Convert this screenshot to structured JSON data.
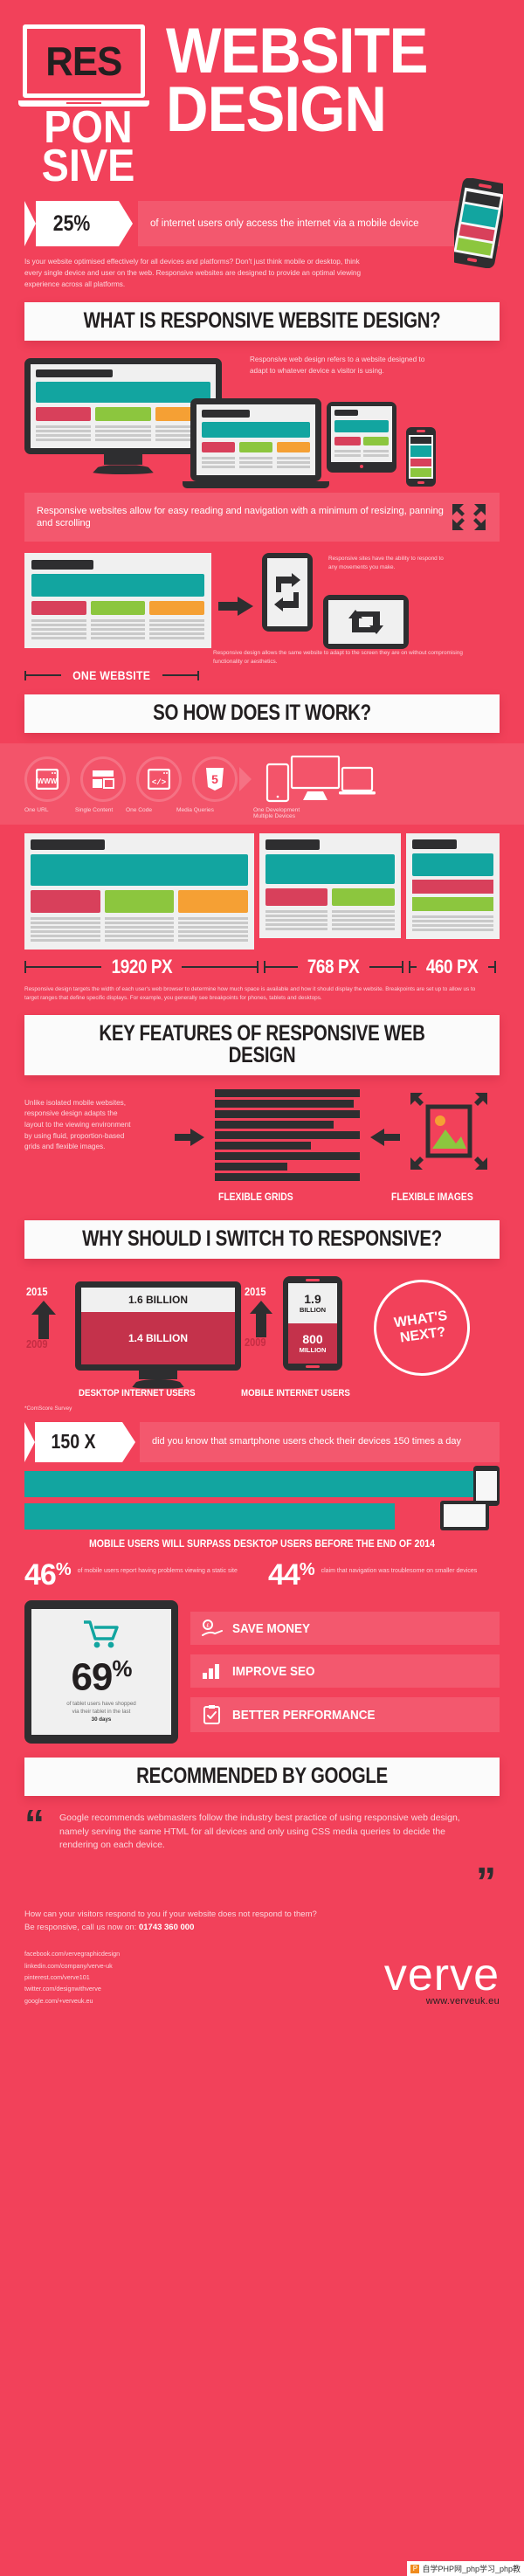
{
  "brand": {
    "accent": "#F2415A",
    "dark": "#2E2E30",
    "teal": "#12A5A0",
    "name": "verve",
    "website": "www.verveuk.eu"
  },
  "header": {
    "res": "RES",
    "pon": "PON",
    "sive": "SIVE",
    "title_line1": "WEBSITE",
    "title_line2": "DESIGN"
  },
  "stat_banner": {
    "value": "25%",
    "text": "of internet users only access the internet via a mobile device"
  },
  "intro": "Is your website optimised effectively for all devices and platforms? Don't just think mobile or desktop, think every single device and user on the web. Responsive websites are designed to provide an optimal viewing experience across all platforms.",
  "section_what": {
    "heading": "WHAT IS RESPONSIVE WEBSITE DESIGN?",
    "note": "Responsive web design refers to a website designed to adapt to whatever device a visitor is using.",
    "resize_banner": "Responsive websites allow for easy reading and navigation with a minimum of resizing, panning and scrolling",
    "one_website_label": "ONE WEBSITE",
    "rotate_note": "Responsive sites have the ability to respond to any movements you make.",
    "adapt_note": "Responsive design allows the same website to adapt to the screen they are on without compromising functionality or aesthetics."
  },
  "section_how": {
    "heading": "SO HOW DOES IT WORK?",
    "steps": [
      {
        "icon": "www-browser-icon",
        "label": "One URL"
      },
      {
        "icon": "single-content-icon",
        "label": "Single Content"
      },
      {
        "icon": "code-icon",
        "label": "One Code"
      },
      {
        "icon": "html5-icon",
        "label": "Media Queries"
      }
    ],
    "result_label_line1": "One Development",
    "result_label_line2": "Multiple Devices",
    "breakpoints": [
      "1920 PX",
      "768 PX",
      "460 PX"
    ],
    "breakpoint_note": "Responsive design targets the width of each user's web browser to determine how much space is available and how it should display the website. Breakpoints are set up to allow us to target ranges that define specific displays. For example, you generally see breakpoints for phones, tablets and desktops."
  },
  "section_key": {
    "heading": "KEY FEATURES OF RESPONSIVE WEB DESIGN",
    "note": "Unlike isolated mobile websites, responsive design adapts the layout to the viewing environment by using fluid, proportion-based grids and flexible images.",
    "label_grids": "FLEXIBLE GRIDS",
    "label_images": "FLEXIBLE IMAGES"
  },
  "section_switch": {
    "heading": "WHY SHOULD I SWITCH TO RESPONSIVE?",
    "desktop": {
      "year_new": "2015",
      "year_old": "2009",
      "value_new": "1.6 BILLION",
      "value_old": "1.4 BILLION",
      "caption": "DESKTOP INTERNET USERS"
    },
    "mobile": {
      "year_new": "2015",
      "year_old": "2009",
      "value_new_line1": "1.9",
      "value_new_line2": "BILLION",
      "value_old_line1": "800",
      "value_old_line2": "MILLION",
      "caption": "MOBILE INTERNET USERS"
    },
    "whats_next": "WHAT'S NEXT?",
    "source": "*ComScore Survey"
  },
  "section_150": {
    "value": "150 X",
    "text": "did you know that smartphone users check their devices 150 times a day",
    "surpass": "MOBILE USERS WILL SURPASS DESKTOP USERS BEFORE THE END OF 2014"
  },
  "percent_stats": [
    {
      "value": "46",
      "suffix": "%",
      "note": "of mobile users report having problems viewing a static site"
    },
    {
      "value": "44",
      "suffix": "%",
      "note": "claim that navigation was troublesome on smaller devices"
    }
  ],
  "tablet_stat": {
    "value": "69",
    "suffix": "%",
    "note_line1": "of tablet users have shopped",
    "note_line2": "via their tablet in the last",
    "note_line3": "30 days"
  },
  "benefits": [
    {
      "icon": "money-hand-icon",
      "label": "SAVE MONEY"
    },
    {
      "icon": "chart-bars-icon",
      "label": "IMPROVE SEO"
    },
    {
      "icon": "clipboard-check-icon",
      "label": "BETTER PERFORMANCE"
    }
  ],
  "section_google": {
    "heading": "RECOMMENDED BY GOOGLE",
    "quote": "Google recommends webmasters follow the industry best practice of using responsive web design, namely serving the same HTML for all devices and only using CSS media queries to decide the rendering on each device.",
    "quote_open": "“",
    "quote_close": "”"
  },
  "cta": {
    "line1": "How can your visitors respond to you if your website does not respond to them?",
    "line2_prefix": "Be responsive, call us now on: ",
    "phone": "01743 360 000"
  },
  "social_links": [
    "facebook.com/vervegraphicdesign",
    "linkedin.com/company/verve-uk",
    "pinterest.com/verve101",
    "twitter.com/designwithverve",
    "google.com/+verveuk.eu"
  ],
  "watermark": "自学PHP网_php学习_php教"
}
